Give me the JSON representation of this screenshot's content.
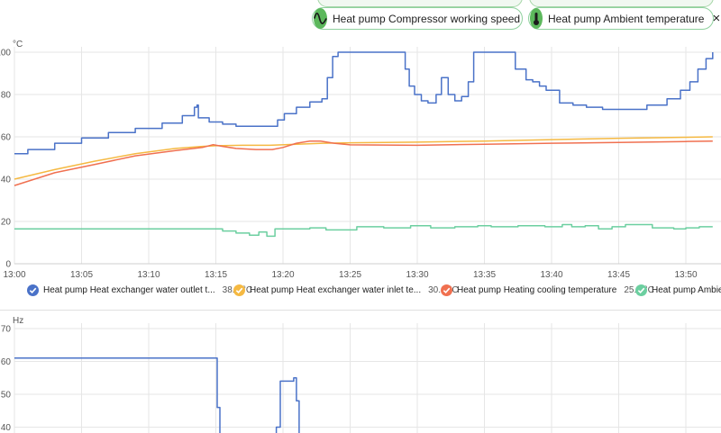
{
  "chips": [
    {
      "label": "Heat pump Compressor working speed",
      "icon": "sine-wave-icon",
      "close": "×"
    },
    {
      "label": "Heat pump Ambient temperature",
      "icon": "thermometer-icon",
      "close": "×"
    }
  ],
  "colors": {
    "blue": "#4a72c8",
    "orange": "#f5b942",
    "red": "#f07050",
    "green": "#6ccfa0",
    "chip_green": "#5cb85c"
  },
  "legend": [
    {
      "name": "Heat pump Heat exchanger water outlet t...",
      "value": "38.6 °C",
      "color": "#4a72c8"
    },
    {
      "name": "Heat pump Heat exchanger water inlet te...",
      "value": "30.6 °C",
      "color": "#f5b942"
    },
    {
      "name": "Heat pump Heating cooling temperature",
      "value": "25.3 °C",
      "color": "#f07050"
    },
    {
      "name": "Heat pump Ambien",
      "value": "",
      "color": "#6ccfa0"
    }
  ],
  "chart_data": [
    {
      "type": "line",
      "unit": "°C",
      "ylim": [
        0,
        100
      ],
      "y_ticks": [
        "100",
        "80",
        "60",
        "40",
        "20",
        "0"
      ],
      "x_ticks": [
        "13:00",
        "13:05",
        "13:10",
        "13:15",
        "13:20",
        "13:25",
        "13:30",
        "13:35",
        "13:40",
        "13:45",
        "13:50"
      ],
      "x_unit": "minutes after 13:00",
      "grid": true,
      "series": [
        {
          "name": "Heat pump Heat exchanger water outlet t...",
          "color": "#4a72c8",
          "step": true,
          "x": [
            0,
            1,
            3,
            5,
            7,
            9,
            11,
            12.5,
            13.4,
            13.6,
            13.7,
            14.5,
            15.5,
            16.5,
            18,
            19.6,
            20.1,
            21,
            22,
            22.9,
            23.3,
            23.7,
            24.1,
            26,
            28.7,
            29.1,
            29.4,
            29.8,
            30.3,
            30.8,
            31.4,
            31.8,
            32.3,
            32.8,
            33.3,
            33.8,
            34.2,
            34.7,
            35.2,
            36.1,
            36.8,
            37.3,
            38.1,
            38.6,
            39.1,
            39.6,
            40.6,
            41.6,
            42.6,
            43.8,
            45.5,
            47.1,
            48.6,
            49.6,
            50.3,
            50.9,
            51.5,
            52
          ],
          "y": [
            52,
            54,
            57,
            59.5,
            62,
            64,
            66.5,
            70,
            74,
            75,
            69,
            67,
            66,
            65,
            65,
            68,
            71,
            74,
            76.5,
            78,
            88,
            98,
            100,
            100,
            100,
            92,
            84,
            80,
            77,
            76,
            80,
            88,
            80,
            77,
            79,
            86,
            100,
            100,
            100,
            100,
            100,
            92,
            87,
            86,
            84,
            82,
            76,
            75,
            74,
            73,
            73,
            75,
            78,
            82,
            86,
            92,
            97,
            100
          ]
        },
        {
          "name": "Heat pump Heat exchanger water inlet te...",
          "color": "#f5b942",
          "x": [
            0,
            3,
            6,
            9,
            12,
            14,
            15,
            17,
            19,
            21,
            23,
            25,
            30,
            35,
            40,
            45,
            50,
            52
          ],
          "y": [
            40,
            44.5,
            48.5,
            52,
            54.5,
            55.5,
            55.8,
            56,
            56,
            56.5,
            57,
            57.2,
            57.5,
            58,
            58.7,
            59.3,
            59.8,
            60
          ]
        },
        {
          "name": "Heat pump Heating cooling temperature",
          "color": "#f07050",
          "x": [
            0,
            3,
            6,
            9,
            12,
            14,
            14.8,
            15.5,
            16.5,
            18,
            19.2,
            20,
            21,
            22,
            22.8,
            23.8,
            25,
            30,
            35,
            40,
            45,
            50,
            52
          ],
          "y": [
            37,
            43,
            47,
            51,
            53.5,
            55,
            56.3,
            55.5,
            54.5,
            54,
            54,
            55,
            57,
            58,
            58,
            57,
            56.2,
            56,
            56.5,
            57,
            57.3,
            57.8,
            58
          ]
        },
        {
          "name": "Heat pump Ambient temperature",
          "color": "#6ccfa0",
          "step": true,
          "x": [
            0,
            8,
            12,
            14.5,
            15.5,
            16.5,
            17.5,
            18.2,
            18.8,
            19.4,
            20.5,
            22,
            23.2,
            25.5,
            27.5,
            29.5,
            31,
            32.8,
            34.5,
            35.5,
            37.5,
            39.5,
            40.8,
            41.5,
            42.5,
            43.5,
            44.5,
            45.5,
            47.5,
            49.1,
            50,
            51,
            52
          ],
          "y": [
            16.5,
            16.5,
            16.5,
            16.5,
            15.5,
            14.5,
            13.5,
            15,
            13,
            16.5,
            16.5,
            17,
            16,
            17.5,
            17,
            18,
            17,
            17.5,
            18,
            17.5,
            18,
            17.5,
            18.5,
            17.5,
            18,
            16.5,
            17.5,
            18.5,
            17,
            16.5,
            17,
            17.5,
            17.5
          ]
        }
      ]
    },
    {
      "type": "line",
      "unit": "Hz",
      "ylim": [
        33,
        70
      ],
      "y_ticks": [
        "70",
        "60",
        "50",
        "40"
      ],
      "x_unit": "minutes after 13:00",
      "grid": true,
      "series": [
        {
          "name": "Heat pump Compressor working speed",
          "color": "#4a72c8",
          "step": true,
          "x": [
            0,
            15.1,
            15.3,
            19.3,
            19.5,
            19.8,
            20.8,
            21.0,
            21.2
          ],
          "y": [
            61,
            46,
            33,
            33,
            40,
            54,
            55,
            48,
            33
          ]
        }
      ]
    }
  ]
}
